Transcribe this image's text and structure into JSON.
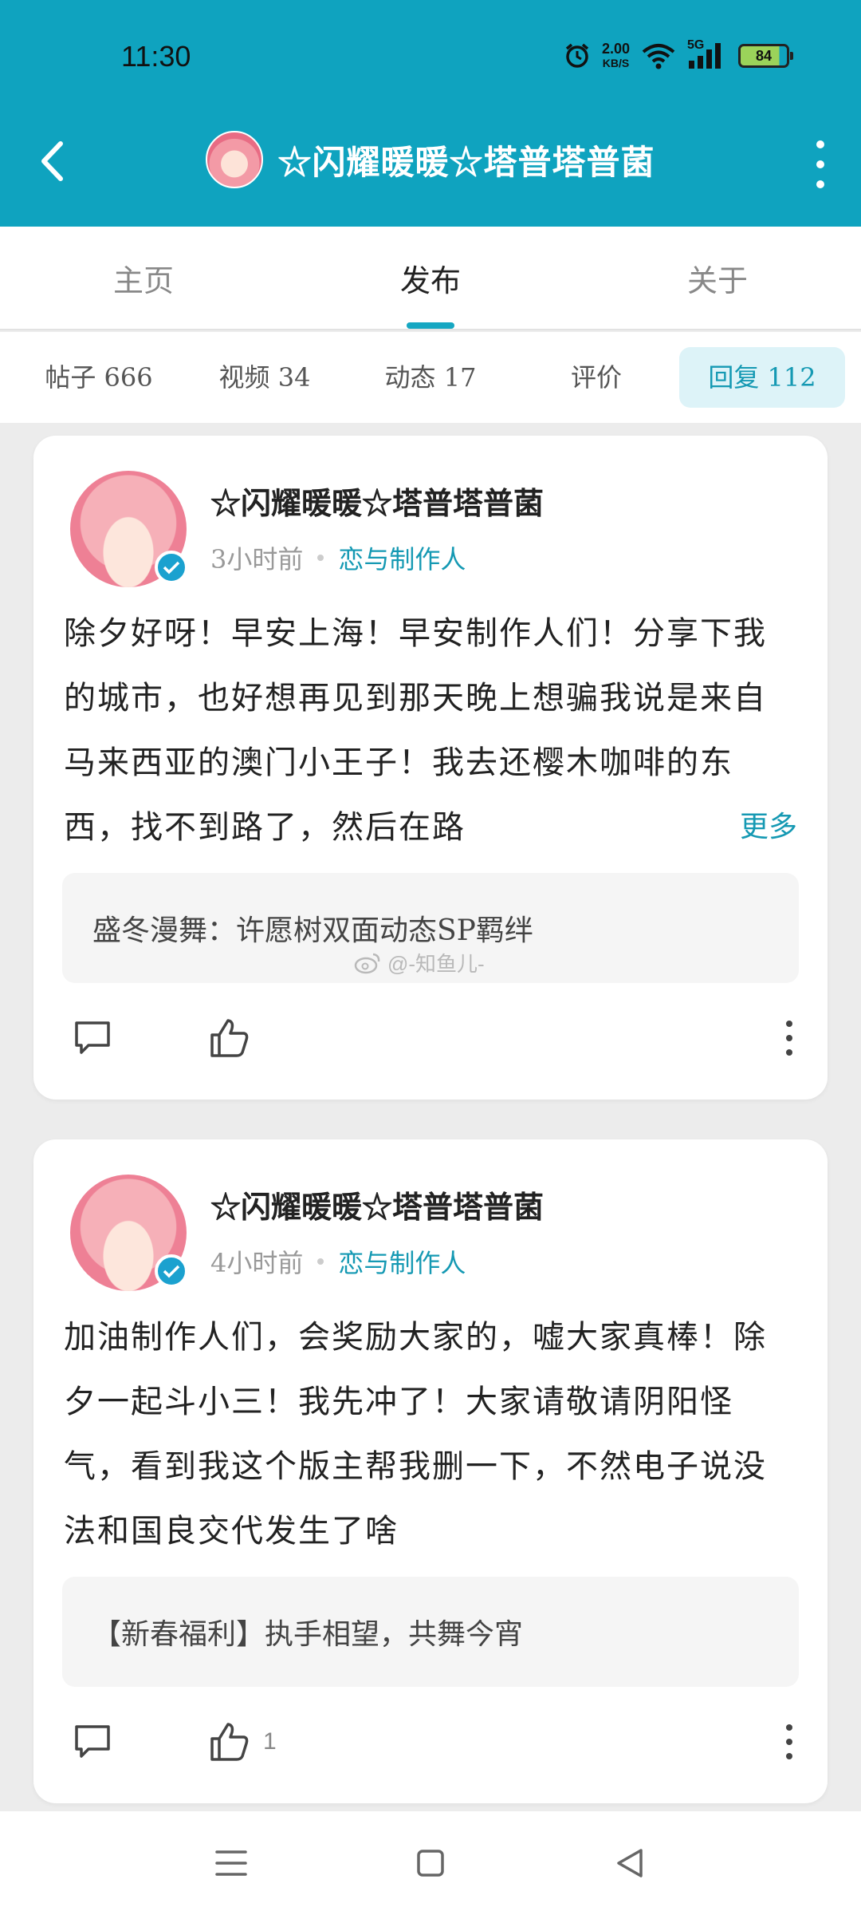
{
  "status_bar": {
    "time": "11:30",
    "net_speed_value": "2.00",
    "net_speed_unit": "KB/S",
    "network_type": "5G",
    "battery": "84"
  },
  "appbar": {
    "title": "☆闪耀暖暖☆塔普塔普菌"
  },
  "tabs": [
    {
      "label": "主页"
    },
    {
      "label": "发布"
    },
    {
      "label": "关于"
    }
  ],
  "subtabs": [
    {
      "label": "帖子 666"
    },
    {
      "label": "视频 34"
    },
    {
      "label": "动态 17"
    },
    {
      "label": "评价"
    },
    {
      "label": "回复 112"
    }
  ],
  "posts": [
    {
      "author": "☆闪耀暖暖☆塔普塔普菌",
      "time": "3小时前",
      "topic": "恋与制作人",
      "body": "除夕好呀！早安上海！早安制作人们！分享下我的城市，也好想再见到那天晚上想骗我说是来自马来西亚的澳门小王子！我去还樱木咖啡的东西，找不到路了，然后在路",
      "more_label": "更多",
      "quote": "盛冬漫舞：许愿树双面动态SP羁绊",
      "like_count": ""
    },
    {
      "author": "☆闪耀暖暖☆塔普塔普菌",
      "time": "4小时前",
      "topic": "恋与制作人",
      "body": "加油制作人们，会奖励大家的，嘘大家真棒！除夕一起斗小三！我先冲了！大家请敬请阴阳怪气，看到我这个版主帮我删一下，不然电子说没法和国良交代发生了啥",
      "quote": "【新春福利】执手相望，共舞今宵",
      "like_count": "1"
    }
  ],
  "watermark": "@-知鱼儿-",
  "colors": {
    "accent": "#0fa3bf",
    "link": "#1599b3",
    "subtab_active_bg": "#ddf3f8"
  },
  "icons": [
    "alarm-icon",
    "wifi-icon",
    "signal-icon",
    "battery-icon",
    "back-arrow-icon",
    "more-vertical-icon",
    "verified-icon",
    "comment-icon",
    "thumbs-up-icon",
    "menu-icon",
    "home-square-icon",
    "back-triangle-icon"
  ]
}
